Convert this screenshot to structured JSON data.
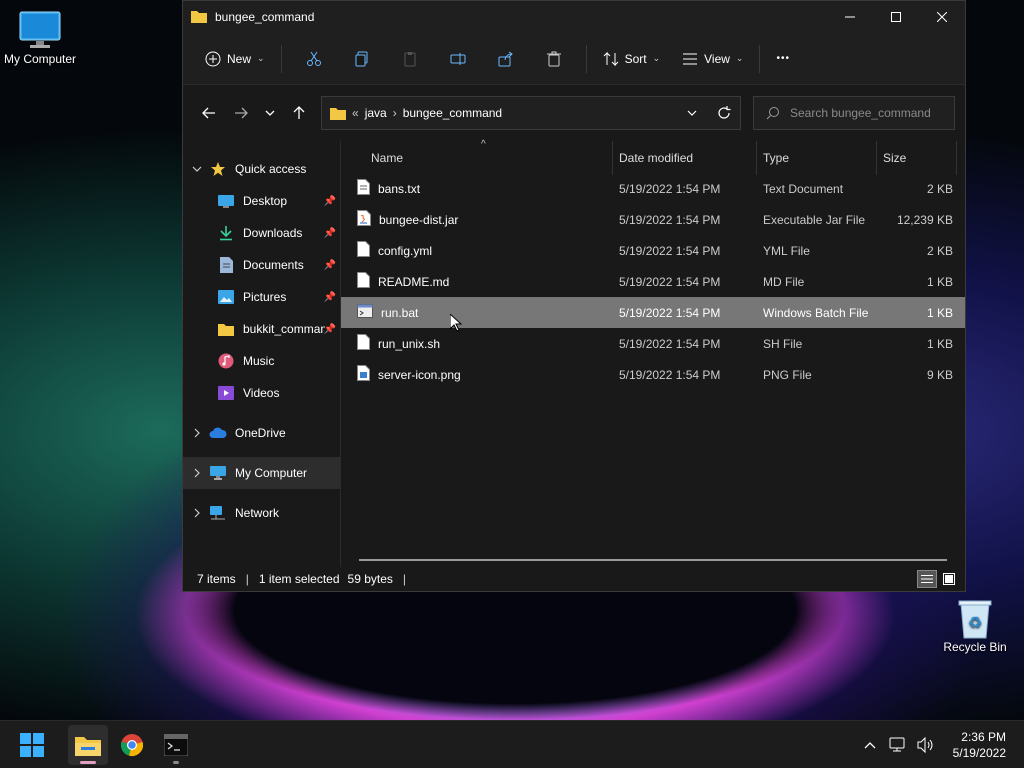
{
  "desktop": {
    "icons": [
      {
        "label": "My Computer"
      },
      {
        "label": "Recycle Bin"
      }
    ]
  },
  "window": {
    "title": "bungee_command",
    "toolbar": {
      "new_label": "New",
      "sort_label": "Sort",
      "view_label": "View",
      "more_label": "•••"
    },
    "address": {
      "overflow": "«",
      "crumbs": [
        "java",
        "bungee_command"
      ]
    },
    "search": {
      "placeholder": "Search bungee_command"
    },
    "sidebar": {
      "quick_access": "Quick access",
      "items": [
        {
          "label": "Desktop",
          "pinned": true
        },
        {
          "label": "Downloads",
          "pinned": true
        },
        {
          "label": "Documents",
          "pinned": true
        },
        {
          "label": "Pictures",
          "pinned": true
        },
        {
          "label": "bukkit_command",
          "pinned": true
        },
        {
          "label": "Music",
          "pinned": false
        },
        {
          "label": "Videos",
          "pinned": false
        }
      ],
      "onedrive": "OneDrive",
      "my_computer": "My Computer",
      "network": "Network"
    },
    "columns": {
      "name": "Name",
      "date": "Date modified",
      "type": "Type",
      "size": "Size"
    },
    "files": [
      {
        "name": "bans.txt",
        "date": "5/19/2022 1:54 PM",
        "type": "Text Document",
        "size": "2 KB",
        "icon": "text-file-icon"
      },
      {
        "name": "bungee-dist.jar",
        "date": "5/19/2022 1:54 PM",
        "type": "Executable Jar File",
        "size": "12,239 KB",
        "icon": "jar-file-icon"
      },
      {
        "name": "config.yml",
        "date": "5/19/2022 1:54 PM",
        "type": "YML File",
        "size": "2 KB",
        "icon": "file-icon"
      },
      {
        "name": "README.md",
        "date": "5/19/2022 1:54 PM",
        "type": "MD File",
        "size": "1 KB",
        "icon": "file-icon"
      },
      {
        "name": "run.bat",
        "date": "5/19/2022 1:54 PM",
        "type": "Windows Batch File",
        "size": "1 KB",
        "icon": "batch-file-icon",
        "selected": true
      },
      {
        "name": "run_unix.sh",
        "date": "5/19/2022 1:54 PM",
        "type": "SH File",
        "size": "1 KB",
        "icon": "file-icon"
      },
      {
        "name": "server-icon.png",
        "date": "5/19/2022 1:54 PM",
        "type": "PNG File",
        "size": "9 KB",
        "icon": "image-file-icon"
      }
    ],
    "status": {
      "count": "7 items",
      "selected": "1 item selected",
      "size": "59 bytes"
    }
  },
  "taskbar": {
    "clock_time": "2:36 PM",
    "clock_date": "5/19/2022"
  },
  "colors": {
    "accent_folder": "#f2c744",
    "selection": "#777777"
  }
}
